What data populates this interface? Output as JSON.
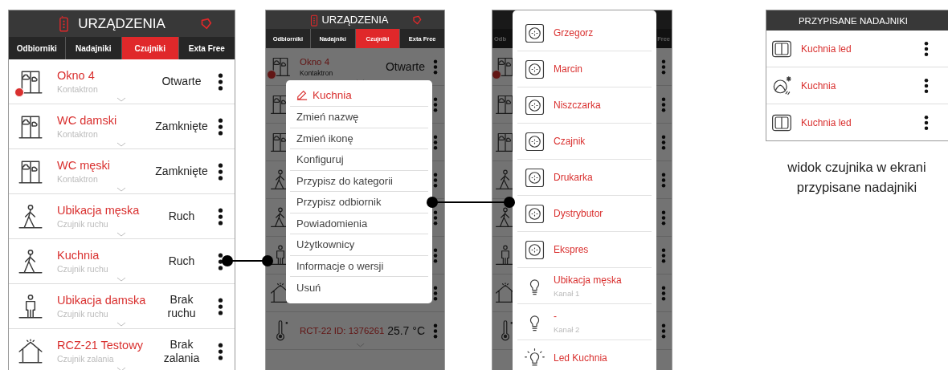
{
  "devices_screen": {
    "title": "URZĄDZENIA",
    "tabs": [
      {
        "label": "Odbiorniki",
        "selected": false
      },
      {
        "label": "Nadajniki",
        "selected": false
      },
      {
        "label": "Czujniki",
        "selected": true
      },
      {
        "label": "Exta Free",
        "selected": false
      }
    ],
    "rows": [
      {
        "kind": "door",
        "alert": true,
        "name": "Okno 4",
        "type": "Kontaktron",
        "status": "Otwarte"
      },
      {
        "kind": "door",
        "alert": false,
        "name": "WC damski",
        "type": "Kontaktron",
        "status": "Zamknięte"
      },
      {
        "kind": "door",
        "alert": false,
        "name": "WC męski",
        "type": "Kontaktron",
        "status": "Zamknięte"
      },
      {
        "kind": "walker",
        "alert": false,
        "name": "Ubikacja męska",
        "type": "Czujnik ruchu",
        "status": "Ruch"
      },
      {
        "kind": "walker",
        "alert": false,
        "name": "Kuchnia",
        "type": "Czujnik ruchu",
        "status": "Ruch"
      },
      {
        "kind": "standing",
        "alert": false,
        "name": "Ubikacja damska",
        "type": "Czujnik ruchu",
        "status": "Brak ruchu"
      },
      {
        "kind": "house",
        "alert": false,
        "name": "RCZ-21 Testowy",
        "type": "Czujnik zalania",
        "status": "Brak zalania"
      }
    ]
  },
  "menu_screen": {
    "title": "URZĄDZENIA",
    "tabs": [
      {
        "label": "Odbiorniki",
        "selected": false
      },
      {
        "label": "Nadajniki",
        "selected": false
      },
      {
        "label": "Czujniki",
        "selected": true
      },
      {
        "label": "Exta Free",
        "selected": false
      }
    ],
    "rows": [
      {
        "kind": "door",
        "alert": true,
        "name": "Okno 4",
        "type": "Kontaktron",
        "status": "Otwarte"
      },
      {
        "kind": "door",
        "alert": false
      },
      {
        "kind": "door",
        "alert": false
      },
      {
        "kind": "walker",
        "alert": false
      },
      {
        "kind": "walker",
        "alert": false
      },
      {
        "kind": "standing",
        "alert": false
      },
      {
        "kind": "house",
        "alert": false
      },
      {
        "kind": "thermometer",
        "alert": false,
        "name": "RCT-22 ID: 1376261",
        "status": "25.7 °C"
      }
    ],
    "menu": {
      "title": "Kuchnia",
      "items": [
        "Zmień nazwę",
        "Zmień ikonę",
        "Konfiguruj",
        "Przypisz do kategorii",
        "Przypisz odbiornik",
        "Powiadomienia",
        "Użytkownicy",
        "Informacje o wersji",
        "Usuń"
      ]
    }
  },
  "receiver_screen": {
    "tab_fragments": [
      "Odb",
      "Free"
    ],
    "rows": [
      {
        "kind": "door",
        "alert": true
      },
      {
        "kind": "door",
        "alert": false
      },
      {
        "kind": "door",
        "alert": false
      },
      {
        "kind": "walker",
        "alert": false
      },
      {
        "kind": "walker",
        "alert": false
      },
      {
        "kind": "standing",
        "alert": false
      },
      {
        "kind": "house",
        "alert": false
      },
      {
        "kind": "thermometer",
        "alert": false
      }
    ],
    "receivers": [
      {
        "kind": "socket",
        "name": "Grzegorz"
      },
      {
        "kind": "socket",
        "name": "Marcin"
      },
      {
        "kind": "socket",
        "name": "Niszczarka"
      },
      {
        "kind": "socket",
        "name": "Czajnik"
      },
      {
        "kind": "socket",
        "name": "Drukarka"
      },
      {
        "kind": "socket",
        "name": "Dystrybutor"
      },
      {
        "kind": "socket",
        "name": "Ekspres"
      },
      {
        "kind": "bulb",
        "name": "Ubikacja męska",
        "channel": "Kanał 1"
      },
      {
        "kind": "bulb",
        "name": "-",
        "channel": "Kanał 2"
      },
      {
        "kind": "lamp",
        "name": "Led Kuchnia"
      }
    ]
  },
  "assigned_screen": {
    "title": "PRZYPISANE NADAJNIKI",
    "rows": [
      {
        "kind": "switch",
        "name": "Kuchnia led"
      },
      {
        "kind": "sensor",
        "name": "Kuchnia"
      },
      {
        "kind": "switch",
        "name": "Kuchnia led"
      }
    ],
    "caption": [
      "widok czujnika w ekrani",
      "przypisane nadajniki"
    ]
  }
}
